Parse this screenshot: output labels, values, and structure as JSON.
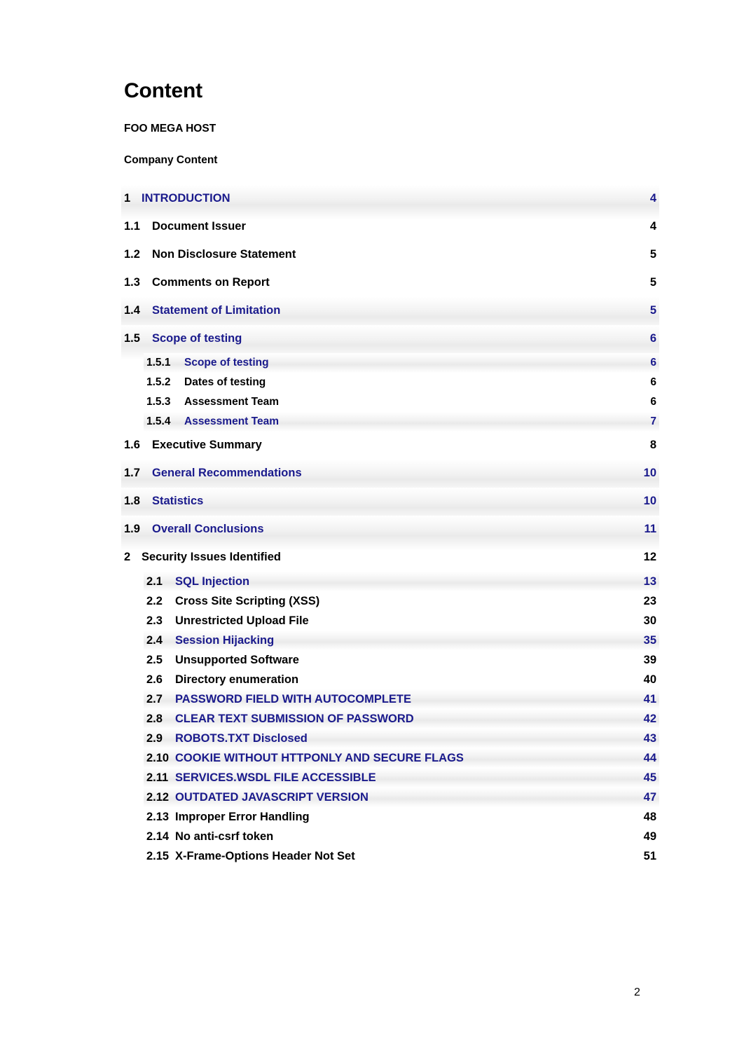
{
  "document": {
    "title": "Content",
    "subtitle_lines": [
      "FOO MEGA HOST",
      "Company Content"
    ],
    "footer_page_number": "2"
  },
  "colors": {
    "link": "#1a1a8c",
    "text": "#000000",
    "page_background": "#ffffff",
    "highlight_band": "#eaeaea"
  },
  "toc": {
    "entries": [
      {
        "number": "1",
        "title": "INTRODUCTION",
        "page": "4",
        "level": 1,
        "link": true
      },
      {
        "number": "1.1",
        "title": "Document Issuer",
        "page": "4",
        "level": 2,
        "link": false
      },
      {
        "number": "1.2",
        "title": "Non Disclosure Statement",
        "page": "5",
        "level": 2,
        "link": false
      },
      {
        "number": "1.3",
        "title": "Comments on Report",
        "page": "5",
        "level": 2,
        "link": false
      },
      {
        "number": "1.4",
        "title": "Statement of Limitation",
        "page": "5",
        "level": 2,
        "link": true
      },
      {
        "number": "1.5",
        "title": "Scope of testing",
        "page": "6",
        "level": 2,
        "link": true
      },
      {
        "number": "1.5.1",
        "title": "Scope of testing",
        "page": "6",
        "level": 3,
        "link": true
      },
      {
        "number": "1.5.2",
        "title": "Dates of testing",
        "page": "6",
        "level": 3,
        "link": false
      },
      {
        "number": "1.5.3",
        "title": "Assessment Team",
        "page": "6",
        "level": 3,
        "link": false
      },
      {
        "number": "1.5.4",
        "title": "Assessment Team",
        "page": "7",
        "level": 3,
        "link": true
      },
      {
        "number": "1.6",
        "title": "Executive Summary",
        "page": "8",
        "level": 2,
        "link": false
      },
      {
        "number": "1.7",
        "title": "General Recommendations",
        "page": "10",
        "level": 2,
        "link": true
      },
      {
        "number": "1.8",
        "title": "Statistics",
        "page": "10",
        "level": 2,
        "link": true
      },
      {
        "number": "1.9",
        "title": "Overall Conclusions",
        "page": "11",
        "level": 2,
        "link": true
      },
      {
        "number": "2",
        "title": "Security Issues Identified",
        "page": "12",
        "level": 1,
        "link": false
      },
      {
        "number": "2.1",
        "title": "SQL Injection",
        "page": "13",
        "level": 4,
        "link": true
      },
      {
        "number": "2.2",
        "title": "Cross Site Scripting (XSS)",
        "page": "23",
        "level": 4,
        "link": false
      },
      {
        "number": "2.3",
        "title": "Unrestricted Upload File",
        "page": "30",
        "level": 4,
        "link": false
      },
      {
        "number": "2.4",
        "title": "Session Hijacking",
        "page": "35",
        "level": 4,
        "link": true
      },
      {
        "number": "2.5",
        "title": "Unsupported Software",
        "page": "39",
        "level": 4,
        "link": false
      },
      {
        "number": "2.6",
        "title": "Directory enumeration",
        "page": "40",
        "level": 5,
        "link": false
      },
      {
        "number": "2.7",
        "title": "PASSWORD FIELD WITH AUTOCOMPLETE",
        "page": "41",
        "level": 5,
        "link": true
      },
      {
        "number": "2.8",
        "title": "CLEAR TEXT SUBMISSION OF PASSWORD",
        "page": "42",
        "level": 5,
        "link": true
      },
      {
        "number": "2.9",
        "title": "ROBOTS.TXT Disclosed",
        "page": "43",
        "level": 5,
        "link": true
      },
      {
        "number": "2.10",
        "title": "COOKIE WITHOUT HTTPONLY AND SECURE FLAGS",
        "page": "44",
        "level": 5,
        "link": true
      },
      {
        "number": "2.11",
        "title": "SERVICES.WSDL FILE ACCESSIBLE",
        "page": "45",
        "level": 5,
        "link": true
      },
      {
        "number": "2.12",
        "title": "OUTDATED JAVASCRIPT VERSION",
        "page": "47",
        "level": 5,
        "link": true
      },
      {
        "number": "2.13",
        "title": "Improper Error Handling",
        "page": "48",
        "level": 5,
        "link": false
      },
      {
        "number": "2.14",
        "title": "No anti-csrf token",
        "page": "49",
        "level": 5,
        "link": false
      },
      {
        "number": "2.15",
        "title": "X-Frame-Options Header Not Set",
        "page": "51",
        "level": 5,
        "link": false
      }
    ]
  }
}
